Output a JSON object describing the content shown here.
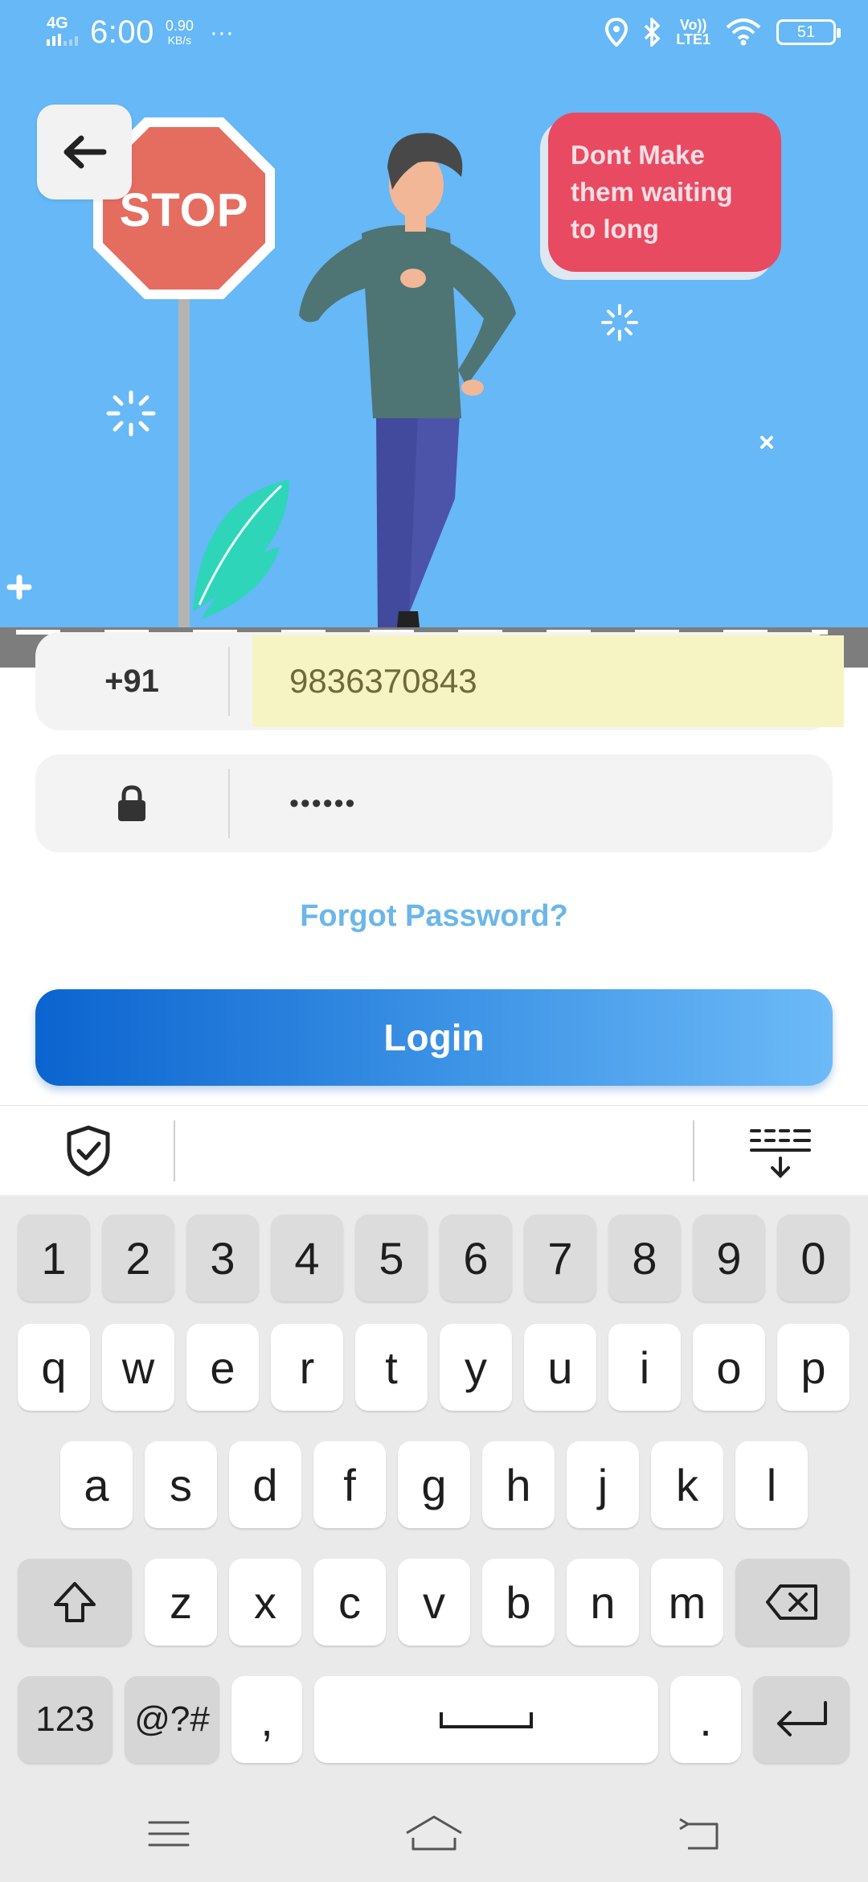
{
  "status_bar": {
    "network": "4G",
    "time": "6:00",
    "speed_value": "0.90",
    "speed_unit": "KB/s",
    "more": "···",
    "lte_top": "Vo))",
    "lte_bottom": "LTE1",
    "battery": "51"
  },
  "hero": {
    "sign_text": "STOP",
    "bubble_line1": "Dont Make",
    "bubble_line2": "them waiting",
    "bubble_line3": "to long"
  },
  "login_form": {
    "country_code": "+91",
    "phone_value": "9836370843",
    "password_value": "••••••",
    "forgot_label": "Forgot Password?",
    "login_label": "Login"
  },
  "keyboard": {
    "row_numbers": [
      "1",
      "2",
      "3",
      "4",
      "5",
      "6",
      "7",
      "8",
      "9",
      "0"
    ],
    "row1": [
      "q",
      "w",
      "e",
      "r",
      "t",
      "y",
      "u",
      "i",
      "o",
      "p"
    ],
    "row2": [
      "a",
      "s",
      "d",
      "f",
      "g",
      "h",
      "j",
      "k",
      "l"
    ],
    "row3": [
      "z",
      "x",
      "c",
      "v",
      "b",
      "n",
      "m"
    ],
    "symbols_label": "123",
    "special_label": "@?#",
    "comma": ",",
    "period": "."
  },
  "colors": {
    "hero_bg": "#66b8f7",
    "bubble": "#e84a62",
    "stop_sign": "#e56d5f",
    "link": "#6bb6ea",
    "login_gradient_start": "#0b64cf",
    "login_gradient_end": "#6cbaf7"
  },
  "icons": {
    "back": "arrow-left-icon",
    "lock": "lock-icon",
    "shield": "shield-check-icon",
    "collapse": "keyboard-collapse-icon",
    "shift": "shift-icon",
    "backspace": "backspace-icon",
    "enter": "enter-icon",
    "space": "space-icon"
  }
}
